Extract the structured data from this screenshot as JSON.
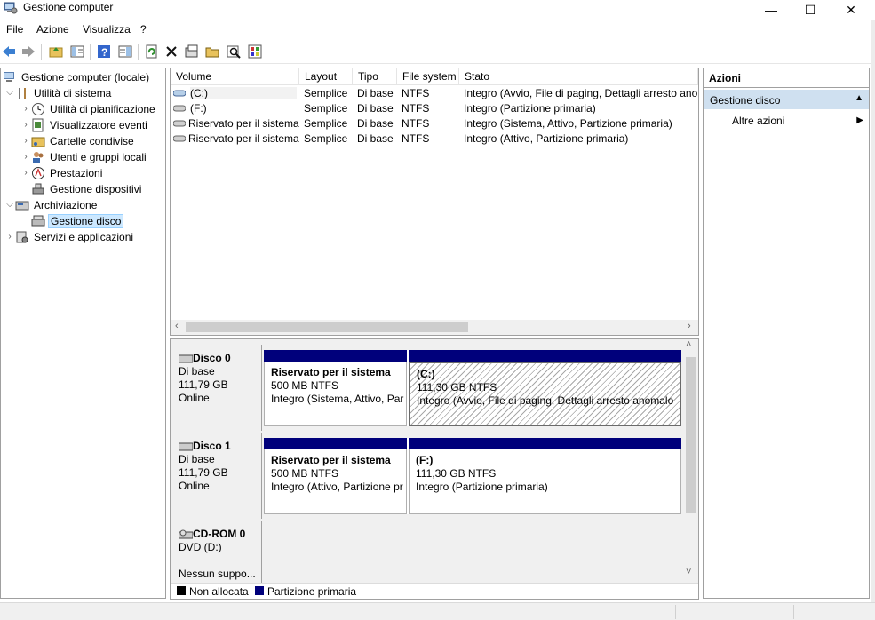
{
  "window": {
    "title": "Gestione computer",
    "controls": {
      "minimize": "—",
      "maximize": "☐",
      "close": "✕"
    }
  },
  "menubar": [
    "File",
    "Azione",
    "Visualizza",
    "?"
  ],
  "toolbar": {
    "icons": [
      "back-arrow-icon",
      "forward-arrow-icon",
      "up-folder-icon",
      "show-hide-tree-icon",
      "help-icon",
      "properties-pane-icon",
      "refresh-icon",
      "delete-icon",
      "properties-icon",
      "open-icon",
      "search-icon",
      "settings-icon"
    ]
  },
  "tree": {
    "root": "Gestione computer (locale)",
    "system_tools": "Utilità di sistema",
    "task_scheduler": "Utilità di pianificazione",
    "event_viewer": "Visualizzatore eventi",
    "shared_folders": "Cartelle condivise",
    "local_users": "Utenti e gruppi locali",
    "performance": "Prestazioni",
    "device_manager": "Gestione dispositivi",
    "storage": "Archiviazione",
    "disk_management": "Gestione disco",
    "services_apps": "Servizi e applicazioni"
  },
  "volumes": {
    "columns": [
      "Volume",
      "Layout",
      "Tipo",
      "File system",
      "Stato"
    ],
    "rows": [
      {
        "volume": "(C:)",
        "layout": "Semplice",
        "type": "Di base",
        "fs": "NTFS",
        "status": "Integro (Avvio, File di paging, Dettagli arresto anom"
      },
      {
        "volume": "(F:)",
        "layout": "Semplice",
        "type": "Di base",
        "fs": "NTFS",
        "status": "Integro (Partizione primaria)"
      },
      {
        "volume": "Riservato per il sistema",
        "layout": "Semplice",
        "type": "Di base",
        "fs": "NTFS",
        "status": "Integro (Sistema, Attivo, Partizione primaria)"
      },
      {
        "volume": "Riservato per il sistema",
        "layout": "Semplice",
        "type": "Di base",
        "fs": "NTFS",
        "status": "Integro (Attivo, Partizione primaria)"
      }
    ]
  },
  "disks": [
    {
      "name": "Disco 0",
      "kind": "Di base",
      "size": "111,79 GB",
      "state": "Online",
      "partitions": [
        {
          "name": "Riservato per il sistema",
          "size": "500 MB NTFS",
          "status": "Integro (Sistema, Attivo, Par"
        },
        {
          "name": "(C:)",
          "size": "111,30 GB NTFS",
          "status": "Integro (Avvio, File di paging, Dettagli arresto anomalo"
        }
      ]
    },
    {
      "name": "Disco 1",
      "kind": "Di base",
      "size": "111,79 GB",
      "state": "Online",
      "partitions": [
        {
          "name": "Riservato per il sistema",
          "size": "500 MB NTFS",
          "status": "Integro (Attivo, Partizione pr"
        },
        {
          "name": "(F:)",
          "size": "111,30 GB NTFS",
          "status": "Integro (Partizione primaria)"
        }
      ]
    },
    {
      "name": "CD-ROM 0",
      "kind": "DVD (D:)",
      "state": "Nessun suppo..."
    }
  ],
  "legend": {
    "unallocated": "Non allocata",
    "primary": "Partizione primaria",
    "colors": {
      "unallocated": "#000000",
      "primary": "#00007b"
    }
  },
  "actions": {
    "title": "Azioni",
    "section": "Gestione disco",
    "more": "Altre azioni"
  }
}
